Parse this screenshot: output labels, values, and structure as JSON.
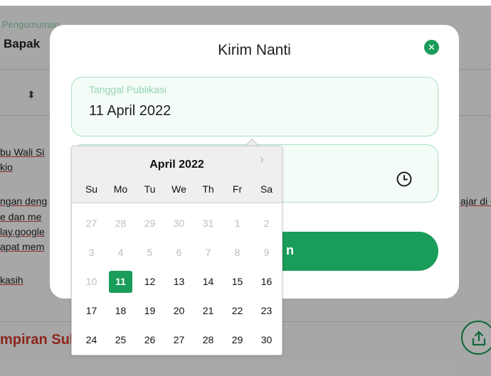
{
  "background": {
    "announcement_label": "Pengumuman",
    "announcement_value": "Bapak",
    "body_lines": [
      "bu Wali Si",
      "kio",
      "ngan deng",
      "e dan me",
      "lay.google",
      "apat mem",
      "kasih"
    ],
    "right_fragment": "ajar di C",
    "section_title": "mpiran Sukses"
  },
  "modal": {
    "title": "Kirim Nanti",
    "date_field": {
      "label": "Tanggal Publikasi",
      "value": "11 April 2022"
    },
    "send_button": {
      "label": "n"
    }
  },
  "calendar": {
    "month": "April 2022",
    "weekdays": [
      "Su",
      "Mo",
      "Tu",
      "We",
      "Th",
      "Fr",
      "Sa"
    ],
    "weeks": [
      [
        "27",
        "28",
        "29",
        "30",
        "31",
        "1",
        "2"
      ],
      [
        "3",
        "4",
        "5",
        "6",
        "7",
        "8",
        "9"
      ],
      [
        "10",
        "11",
        "12",
        "13",
        "14",
        "15",
        "16"
      ],
      [
        "17",
        "18",
        "19",
        "20",
        "21",
        "22",
        "23"
      ],
      [
        "24",
        "25",
        "26",
        "27",
        "28",
        "29",
        "30"
      ]
    ],
    "selected": "11",
    "colors": {
      "accent": "#1a9c5a",
      "muted": "#bdbdbd"
    }
  },
  "icons": {
    "close": "close-icon",
    "clock": "clock-icon",
    "next": "chevron-right-icon",
    "sort": "sort-icon",
    "upload": "upload-icon"
  }
}
